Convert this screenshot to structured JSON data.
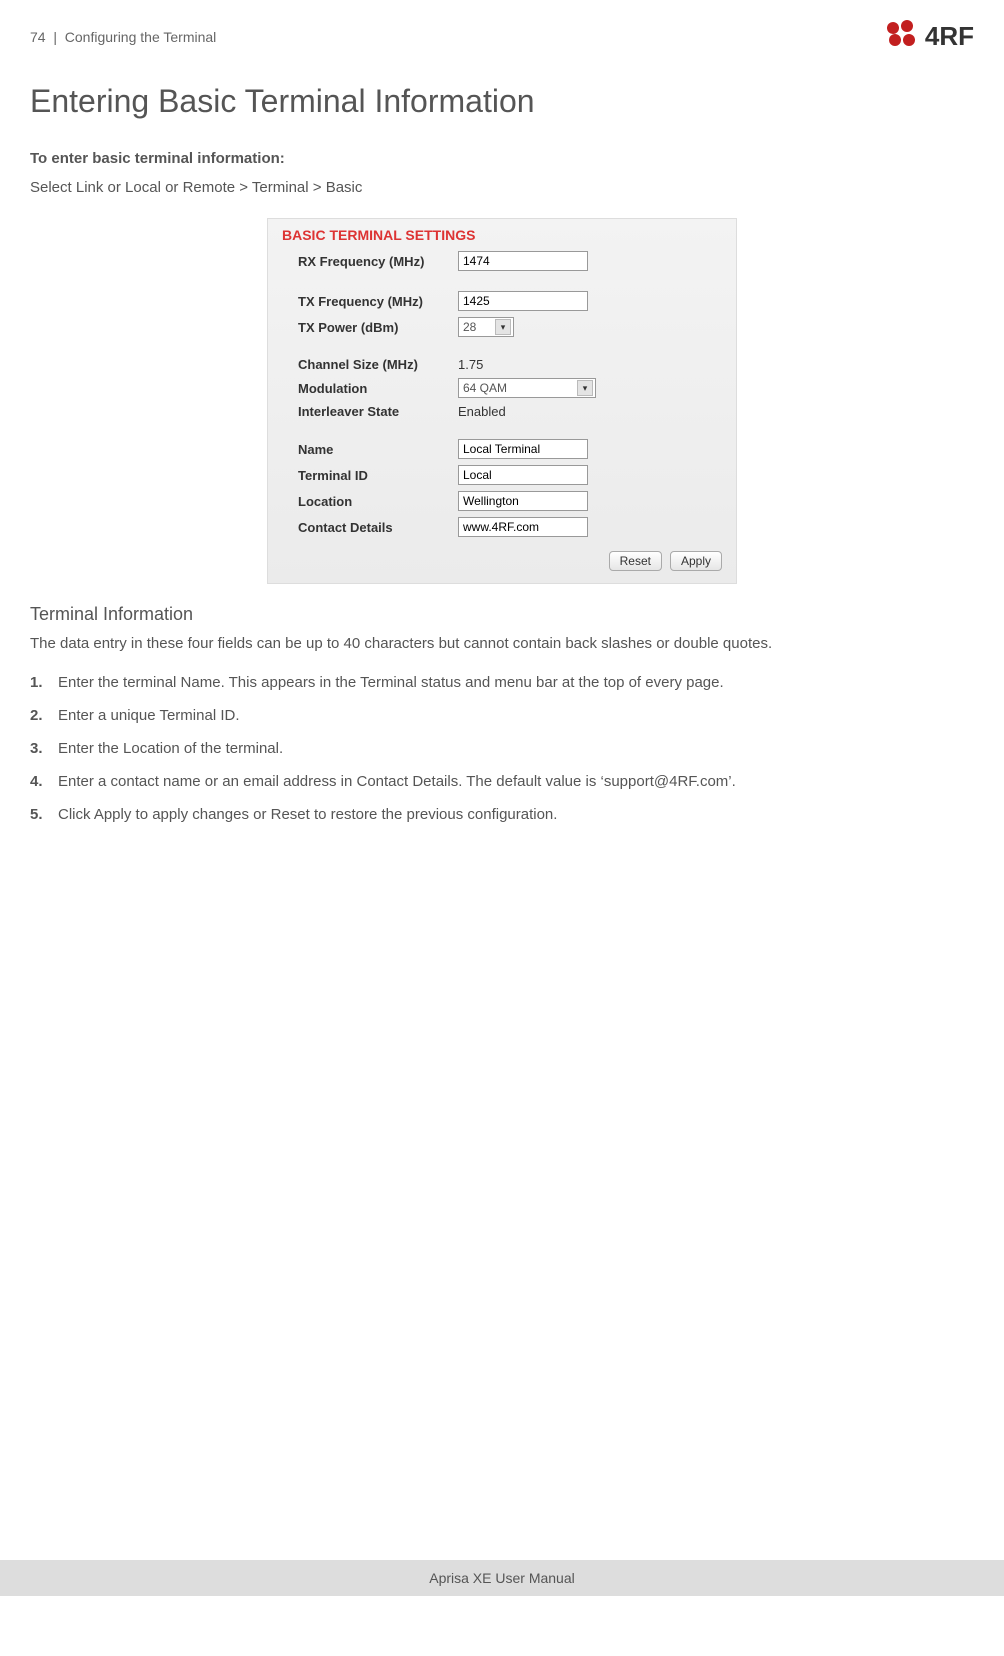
{
  "header": {
    "page_num": "74",
    "section": "Configuring the Terminal",
    "logo_text": "4RF"
  },
  "title": "Entering Basic Terminal Information",
  "intro_bold": "To enter basic terminal information:",
  "intro_text": "Select Link or Local or Remote > Terminal > Basic",
  "panel": {
    "title": "BASIC TERMINAL SETTINGS",
    "rx_freq_label": "RX Frequency (MHz)",
    "rx_freq_value": "1474",
    "tx_freq_label": "TX Frequency (MHz)",
    "tx_freq_value": "1425",
    "tx_power_label": "TX Power (dBm)",
    "tx_power_value": "28",
    "channel_label": "Channel Size (MHz)",
    "channel_value": "1.75",
    "modulation_label": "Modulation",
    "modulation_value": "64 QAM",
    "interleaver_label": "Interleaver State",
    "interleaver_value": "Enabled",
    "name_label": "Name",
    "name_value": "Local Terminal",
    "terminal_id_label": "Terminal ID",
    "terminal_id_value": "Local",
    "location_label": "Location",
    "location_value": "Wellington",
    "contact_label": "Contact Details",
    "contact_value": "www.4RF.com",
    "reset_btn": "Reset",
    "apply_btn": "Apply"
  },
  "section_heading": "Terminal Information",
  "section_body": "The data entry in these four fields can be up to 40 characters but cannot contain back slashes or double quotes.",
  "steps": {
    "s1_num": "1.",
    "s1_text": "Enter the terminal Name. This appears in the Terminal status and menu bar at the top of every page.",
    "s2_num": "2.",
    "s2_text": "Enter a unique Terminal ID.",
    "s3_num": "3.",
    "s3_text": "Enter the Location of the terminal.",
    "s4_num": "4.",
    "s4_text": "Enter a contact name or an email address in Contact Details. The default value is ‘support@4RF.com’.",
    "s5_num": "5.",
    "s5_text": "Click Apply to apply changes or Reset to restore the previous configuration."
  },
  "footer": "Aprisa XE User Manual"
}
